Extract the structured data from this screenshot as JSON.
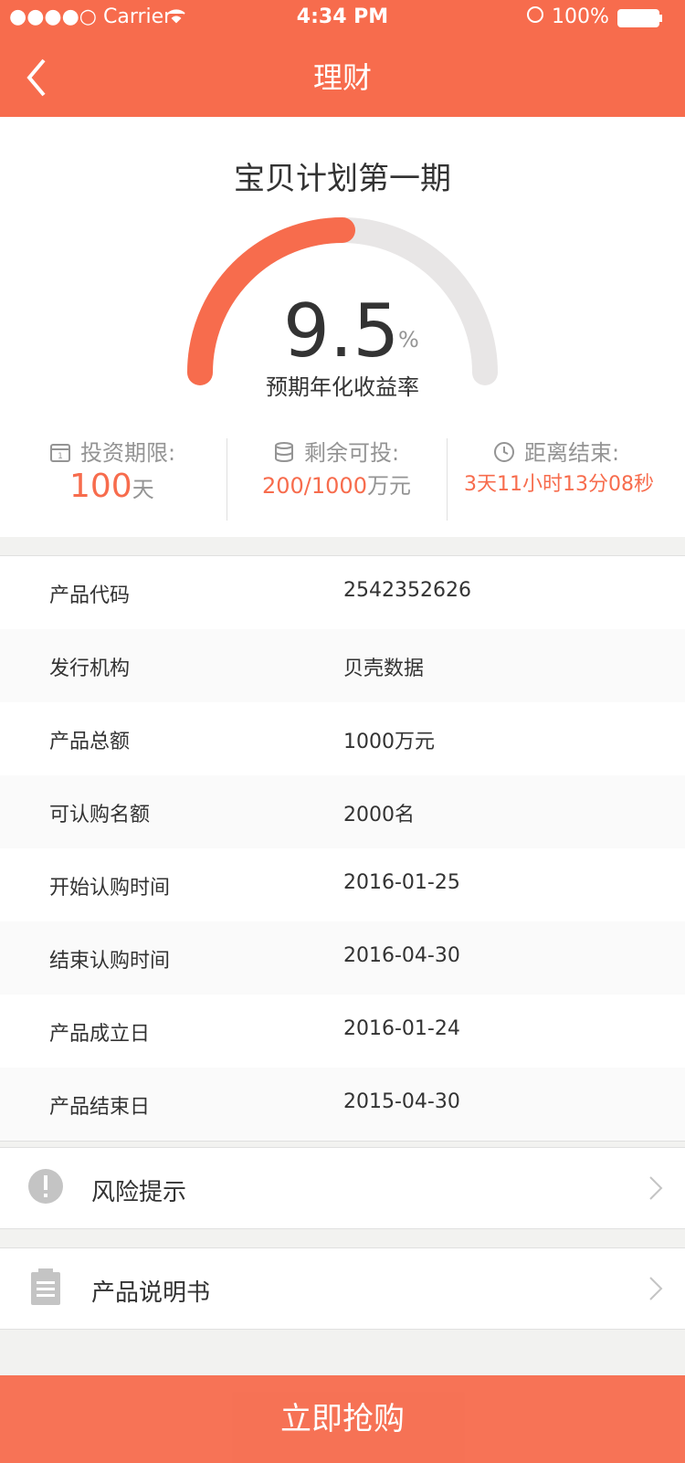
{
  "status_bar": {
    "carrier": "●●●●○ Carrier",
    "time": "4:34 PM",
    "battery": "100%"
  },
  "nav": {
    "title": "理财"
  },
  "product": {
    "title": "宝贝计划第一期",
    "rate_value": "9.5",
    "rate_unit": "%",
    "rate_label": "预期年化收益率",
    "gauge_progress_fraction": 0.5,
    "gauge_color": "#f76c4d",
    "gauge_track_color": "#e8e6e6"
  },
  "stats": [
    {
      "label": "投资期限:",
      "value": "100",
      "unit": "天"
    },
    {
      "label": "剩余可投:",
      "value": "200/1000",
      "unit": "万元"
    },
    {
      "label": "距离结束:",
      "value": "3天11小时13分08秒"
    }
  ],
  "info_rows": [
    {
      "label": "产品代码",
      "value": "2542352626"
    },
    {
      "label": "发行机构",
      "value": "贝壳数据"
    },
    {
      "label": "产品总额",
      "value": "1000万元"
    },
    {
      "label": "可认购名额",
      "value": "2000名"
    },
    {
      "label": "开始认购时间",
      "value": "2016-01-25"
    },
    {
      "label": "结束认购时间",
      "value": "2016-04-30"
    },
    {
      "label": "产品成立日",
      "value": "2016-01-24"
    },
    {
      "label": "产品结束日",
      "value": "2015-04-30"
    }
  ],
  "links": [
    {
      "label": "风险提示"
    },
    {
      "label": "产品说明书"
    }
  ],
  "buy_button": {
    "label": "立即抢购"
  },
  "colors": {
    "brand": "#f76c4d",
    "text": "#333333",
    "muted": "#949494",
    "divider": "#e0e0e0"
  }
}
